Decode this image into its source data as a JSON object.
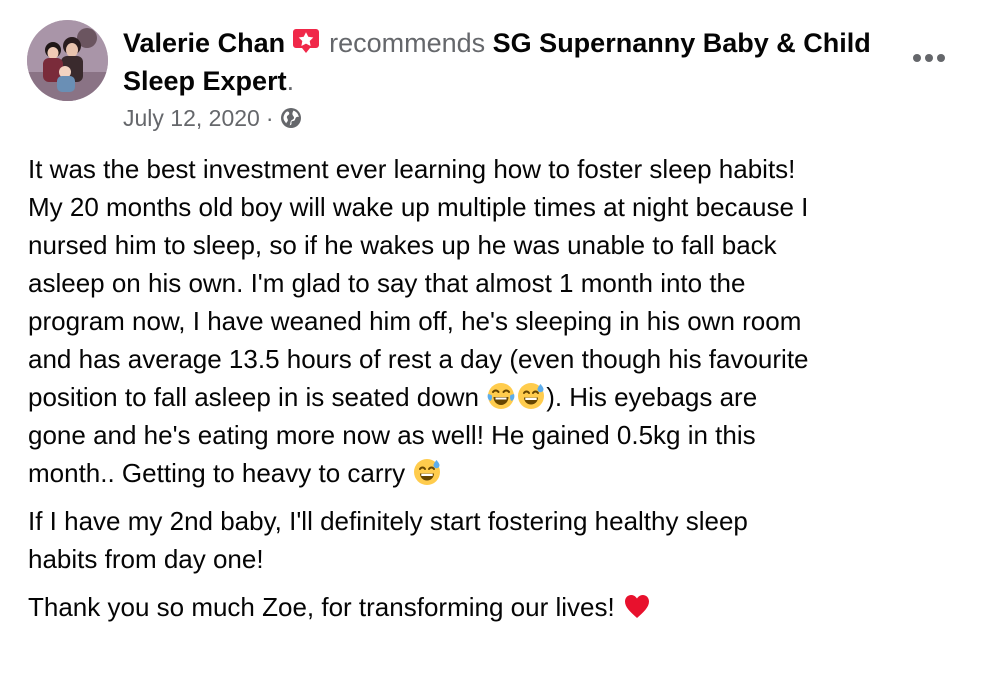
{
  "post": {
    "author": "Valerie Chan",
    "recommends_text": "recommends",
    "page_name": "SG Supernanny Baby & Child Sleep Expert",
    "period": ".",
    "date": "July 12, 2020",
    "separator": "·",
    "audience_icon": "globe-icon",
    "badge_icon": "star-badge-icon",
    "more_icon": "more-options-icon",
    "paragraph1a": "It was the best investment ever learning how to foster sleep habits!\nMy 20 months old boy will wake up multiple times at night because I\nnursed him to sleep, so if he wakes up he was unable to fall back\nasleep on his own. I'm glad to say that almost 1 month into the\nprogram now, I have weaned him off, he's sleeping in his own room\nand has average 13.5 hours of rest a day (even though his favourite\nposition to fall asleep in is seated down ",
    "paragraph1b": "). His eyebags are\ngone and he's eating more now as well! He gained 0.5kg in this\nmonth.. Getting to heavy to carry ",
    "paragraph2": "If I have my 2nd baby, I'll definitely start fostering healthy sleep\nhabits from day one!",
    "paragraph3": "Thank you so much Zoe, for transforming our lives! ",
    "emojis": [
      "tears-of-joy-emoji",
      "grinning-sweat-emoji",
      "grinning-sweat-emoji",
      "red-heart-emoji"
    ]
  },
  "colors": {
    "text": "#050505",
    "secondary": "#65676b",
    "badge": "#f02849",
    "heart": "#e8112d"
  }
}
